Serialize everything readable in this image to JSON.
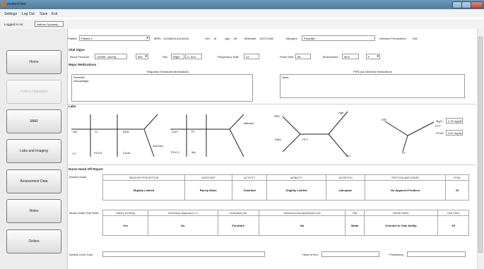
{
  "window": {
    "title": "studentView"
  },
  "menu": [
    "Settings",
    "Log Out",
    "Save",
    "Exit"
  ],
  "logged": {
    "label": "Logged In As:",
    "name": "Nathan Sylvandy"
  },
  "nav": [
    "Home",
    "Patient Highlights",
    "MAR",
    "Labs and Imaging",
    "Assessment Data",
    "Notes",
    "Orders"
  ],
  "patient": {
    "patient_label": "Patient:",
    "patient_value": "Patient 1",
    "mrn_label": "MRN:",
    "mrn_value": "1423#834-34#-8444",
    "sex_label": "Sex:",
    "sex_value": "M",
    "age_label": "Age:",
    "age_value": "66",
    "bday_label": "Birthdate:",
    "bday_value": "10/27/1983",
    "allergies_label": "Allergies:",
    "allergies_value": "Penicillin",
    "infection_label": "Infection Precautions:",
    "infection_value": "N/A"
  },
  "vitals": {
    "title": "Vital Signs",
    "bp_label": "Blood Pressure",
    "bp_value": "130/85",
    "bp_unit": "mm/Hg",
    "bp_site": "669",
    "site_label": "Site",
    "site_value": "Right",
    "site_limb": "U. Arm",
    "resp_label": "Respiratory Rate",
    "resp_value": "13",
    "pulse_label": "Pulse Rate",
    "pulse_value": "88",
    "temp_label": "Temperature",
    "temp_value": "98.8",
    "temp_unit": "F"
  },
  "meds": {
    "title": "Major Medications",
    "scheduled_label": "Regularly Scheduled Medications",
    "scheduled": [
      "Penicillin",
      "Glucophage"
    ],
    "prn_label": "PRN (As-Needed) Medications",
    "prn": [
      "None"
    ]
  },
  "labs": {
    "title": "Labs",
    "bmp": {
      "na": "Na+",
      "cl": "Cl-",
      "bun": "BUN",
      "k": "K+",
      "hco3": "HCO3",
      "creat": "Creat.",
      "glucose": "Glucose"
    },
    "cbc_chem": {
      "ca": "Ca2+",
      "tp": "TP",
      "alb": "Alb",
      "po4": "PO4 3-",
      "mg": "Mg",
      "bilirubin": "Bilirubin"
    },
    "cbc": {
      "rbc": "RBC",
      "hgb": "Hgb",
      "wbc": "WBC",
      "hct": "HCT",
      "plt": "PLT"
    },
    "coag": {
      "inr": "INR",
      "ptt": "PTT",
      "pt": "PT"
    },
    "extra": [
      {
        "label": "Mg2+",
        "value": "1.75 mg/dL"
      },
      {
        "label": "PO43-",
        "value": "2.87 mg/dL"
      }
    ]
  },
  "report": {
    "title": "Nurse Hand Off Report",
    "braden_label": "Braden Scale",
    "braden_headers": [
      "SENSORY PERCEPTION",
      "MOISTURE",
      "ACTIVITY",
      "MOBILITY",
      "NUTRITION",
      "FRICTION AND SHEAR",
      "TOTAL"
    ],
    "braden_values": [
      "Slightly Limited",
      "Rarely Moist",
      "Chairfast",
      "Slightly Limited",
      "Adequate",
      "No Apparent Problem",
      "15"
    ],
    "morse_label": "Morse Scale (Fall Risk)",
    "morse_headers": [
      "History of Falling",
      "Secondary diagnosis (≥ 2)",
      "Ambulatory Aid",
      "Intravenous therapy/heparin lock",
      "Gait",
      "Mental Status",
      "Total Score"
    ],
    "morse_values": [
      "Yes",
      "No",
      "Furniture",
      "No",
      "Weak",
      "Oriented to Own Ability",
      "65"
    ],
    "activity_label": "Activity Level Goal",
    "head_label": "Head of bed",
    "positioning_label": "Positioning"
  }
}
